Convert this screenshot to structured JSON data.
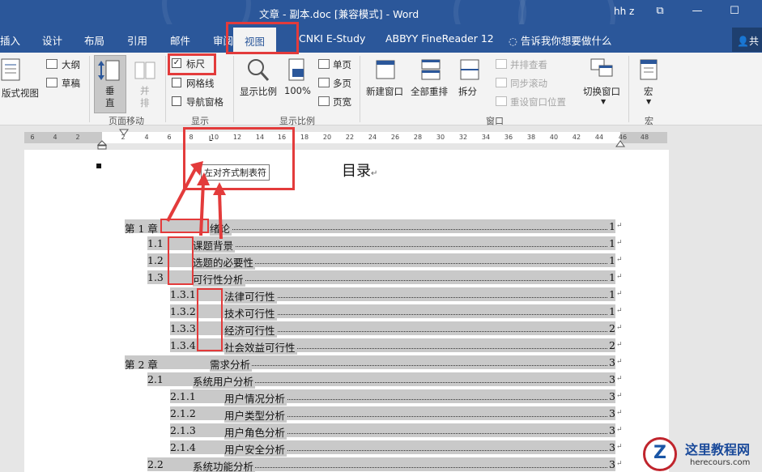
{
  "titlebar": {
    "title": "文章 - 副本.doc [兼容模式] - Word",
    "user": "hh z",
    "restore_symbol": "⧉",
    "minimize_symbol": "—",
    "maximize_symbol": "☐"
  },
  "tabs": {
    "insert": "插入",
    "design": "设计",
    "layout": "布局",
    "references": "引用",
    "mailings": "邮件",
    "review": "审阅",
    "view": "视图",
    "cnki": "CNKI E-Study",
    "abbyy": "ABBYY FineReader 12",
    "tell_me": "告诉我你想要做什么",
    "share": "共"
  },
  "ribbon": {
    "views": {
      "print_layout": "版式视图",
      "outline": "大纲",
      "draft": "草稿"
    },
    "page_movement": {
      "vertical": "垂\n直",
      "side_by_side": "并\n排",
      "group_label": "页面移动"
    },
    "show": {
      "ruler": "标尺",
      "gridlines": "网格线",
      "navigation_pane": "导航窗格",
      "group_label": "显示",
      "ruler_checked": "✓"
    },
    "zoom": {
      "zoom": "显示比例",
      "hundred": "100%",
      "one_page": "单页",
      "multiple_pages": "多页",
      "page_width": "页宽",
      "group_label": "显示比例"
    },
    "window": {
      "new_window": "新建窗口",
      "arrange_all": "全部重排",
      "split": "拆分",
      "view_side_by_side": "并排查看",
      "sync_scrolling": "同步滚动",
      "reset_position": "重设窗口位置",
      "switch_windows": "切换窗口",
      "group_label": "窗口"
    },
    "macros": {
      "macros": "宏",
      "group_label": "宏"
    }
  },
  "ruler": {
    "numbers": [
      "6",
      "4",
      "2",
      "",
      "2",
      "4",
      "6",
      "8",
      "10",
      "12",
      "14",
      "16",
      "18",
      "20",
      "22",
      "24",
      "26",
      "28",
      "30",
      "32",
      "34",
      "36",
      "38",
      "40",
      "42",
      "44",
      "46",
      "48"
    ]
  },
  "tooltip": "左对齐式制表符",
  "document": {
    "bullet": "▪",
    "heading": "目录",
    "heading_mark": "↵",
    "toc": [
      {
        "num": "第 1 章",
        "text": "绪论",
        "page": "1"
      },
      {
        "num": "1.1",
        "text": "课题背景",
        "page": "1"
      },
      {
        "num": "1.2",
        "text": "选题的必要性",
        "page": "1"
      },
      {
        "num": "1.3",
        "text": "可行性分析",
        "page": "1"
      },
      {
        "num": "1.3.1",
        "text": "法律可行性",
        "page": "1"
      },
      {
        "num": "1.3.2",
        "text": "技术可行性",
        "page": "1"
      },
      {
        "num": "1.3.3",
        "text": "经济可行性",
        "page": "2"
      },
      {
        "num": "1.3.4",
        "text": "社会效益可行性",
        "page": "2"
      },
      {
        "num": "第 2 章",
        "text": "需求分析",
        "page": "3"
      },
      {
        "num": "2.1",
        "text": "系统用户分析",
        "page": "3"
      },
      {
        "num": "2.1.1",
        "text": "用户情况分析",
        "page": "3"
      },
      {
        "num": "2.1.2",
        "text": "用户类型分析",
        "page": "3"
      },
      {
        "num": "2.1.3",
        "text": "用户角色分析",
        "page": "3"
      },
      {
        "num": "2.1.4",
        "text": "用户安全分析",
        "page": "3"
      },
      {
        "num": "2.2",
        "text": "系统功能分析",
        "page": "3"
      }
    ],
    "para_mark": "↵"
  },
  "watermark": {
    "logo_letter": "Z",
    "name": "这里教程网",
    "url": "herecours.com"
  },
  "colors": {
    "word_blue": "#2b579a",
    "annotation_red": "#e33b3b",
    "toc_highlight": "#c9c9c9"
  }
}
